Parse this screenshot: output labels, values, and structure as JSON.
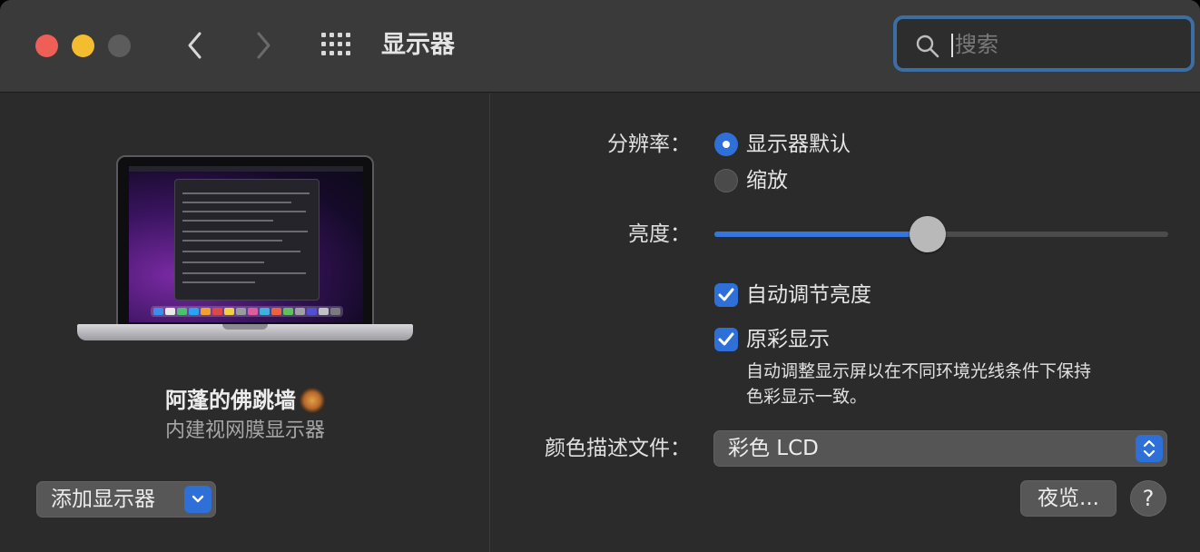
{
  "window": {
    "title": "显示器"
  },
  "toolbar": {
    "back_icon": "chevron-left-icon",
    "forward_icon": "chevron-right-icon",
    "grid_icon": "grid-icon",
    "search_placeholder": "搜索",
    "search_value": ""
  },
  "left": {
    "display_name": "阿蓬的佛跳墙",
    "display_type": "内建视网膜显示器",
    "add_display_label": "添加显示器"
  },
  "settings": {
    "resolution_label": "分辨率：",
    "resolution_options": [
      {
        "label": "显示器默认",
        "selected": true
      },
      {
        "label": "缩放",
        "selected": false
      }
    ],
    "brightness_label": "亮度：",
    "brightness_value": 0.47,
    "auto_brightness": {
      "label": "自动调节亮度",
      "checked": true
    },
    "true_tone": {
      "label": "原彩显示",
      "checked": true
    },
    "true_tone_note_line1": "自动调整显示屏以在不同环境光线条件下保持",
    "true_tone_note_line2": "色彩显示一致。",
    "color_profile_label": "颜色描述文件：",
    "color_profile_value": "彩色 LCD",
    "night_shift_label": "夜览...",
    "help_label": "?"
  },
  "colors": {
    "accent": "#2f6fd8",
    "close": "#ed5f57",
    "minimize": "#f4bd2f",
    "zoom_inactive": "#5c5c5c",
    "search_focus_ring": "#3c6ea1"
  }
}
